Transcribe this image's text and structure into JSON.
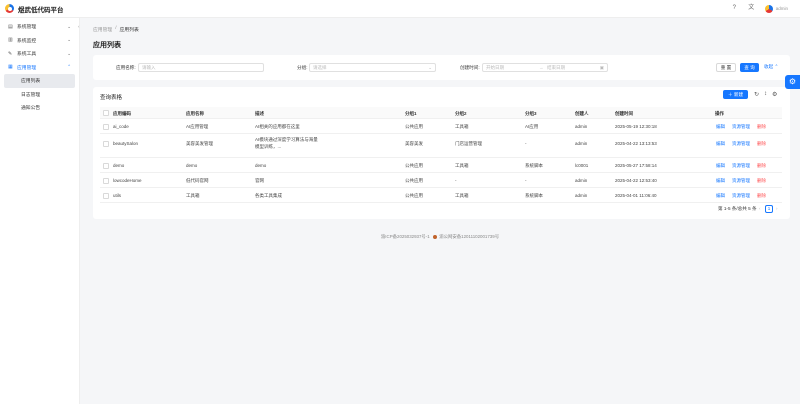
{
  "app": {
    "title": "煜武低代码平台",
    "user": "admin"
  },
  "sidebar": {
    "items": [
      {
        "label": "系统管理",
        "icon": "grid-icon"
      },
      {
        "label": "系统监控",
        "icon": "chart-icon"
      },
      {
        "label": "系统工具",
        "icon": "wrench-icon"
      },
      {
        "label": "应用管理",
        "icon": "apps-icon",
        "open": true,
        "children": [
          "应用列表",
          "日志管理",
          "通知公告"
        ]
      }
    ]
  },
  "breadcrumb": {
    "parent": "应用管理",
    "sep": "/",
    "current": "应用列表"
  },
  "page": {
    "title": "应用列表"
  },
  "filters": {
    "name_label": "应用名称:",
    "name_placeholder": "请输入",
    "group_label": "分组:",
    "group_placeholder": "请选择",
    "time_label": "创建时间:",
    "start_placeholder": "开始日期",
    "end_placeholder": "结束日期",
    "reset": "重 置",
    "query": "查 询",
    "collapse": "收起"
  },
  "table": {
    "title": "查询表格",
    "new_button": "新建",
    "columns": [
      "应用编码",
      "应用名称",
      "描述",
      "分组1",
      "分组2",
      "分组3",
      "创建人",
      "创建时间",
      "操作"
    ],
    "rows": [
      {
        "code": "ai_code",
        "name": "AI应用管理",
        "desc": "AI相关的应用都在这里",
        "g1": "公共应用",
        "g2": "工具箱",
        "g3": "AI应用",
        "creator": "admin",
        "time": "2025-05-19 12:30:18"
      },
      {
        "code": "beautySalon",
        "name": "美容美发管理",
        "desc": "AI模块通过深度学习算法与海量",
        "desc2": "模型训练，...",
        "g1": "美容美发",
        "g2": "门店运营管理",
        "g3": "-",
        "creator": "admin",
        "time": "2025-04-22 13:13:53"
      },
      {
        "code": "demo",
        "name": "demo",
        "desc": "demo",
        "g1": "公共应用",
        "g2": "工具箱",
        "g3": "系统脚本",
        "creator": "lc0001",
        "time": "2025-05-27 17:58:14"
      },
      {
        "code": "lowcodeHome",
        "name": "低代码官网",
        "desc": "官网",
        "g1": "公共应用",
        "g2": "-",
        "g3": "-",
        "creator": "admin",
        "time": "2025-04-22 12:53:40"
      },
      {
        "code": "utils",
        "name": "工具箱",
        "desc": "各类工具集成",
        "g1": "公共应用",
        "g2": "工具箱",
        "g3": "系统脚本",
        "creator": "admin",
        "time": "2025-04-01 11:06:40"
      }
    ],
    "actions": {
      "edit": "编辑",
      "manage": "资源管理",
      "delete": "删除"
    },
    "pager": {
      "total": "第 1-5 条/总共 5 条",
      "current": "1"
    }
  },
  "footer": {
    "icp": "渝ICP备2025032937号-1",
    "police": "渝公网安备12011102001739号"
  },
  "colors": {
    "primary": "#1677ff",
    "danger": "#ff4d4f"
  }
}
